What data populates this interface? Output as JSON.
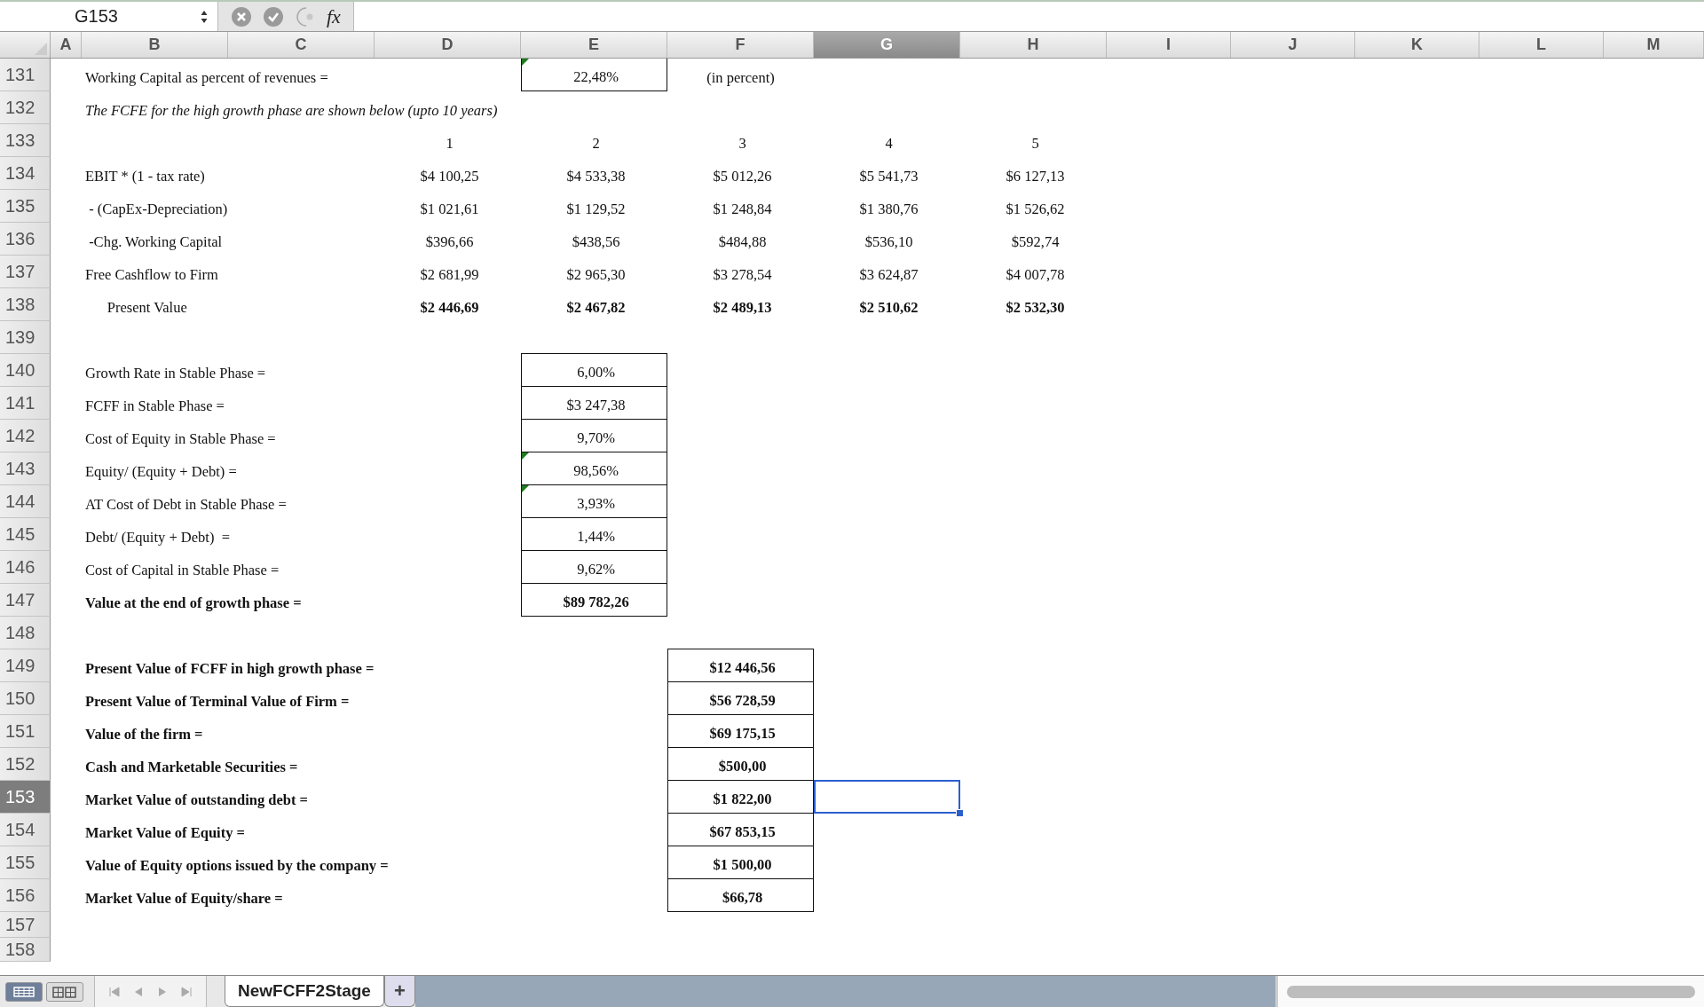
{
  "formula_bar": {
    "name_box": "G153",
    "fx": "fx"
  },
  "columns": [
    {
      "label": "A",
      "selected": false
    },
    {
      "label": "B",
      "selected": false
    },
    {
      "label": "C",
      "selected": false
    },
    {
      "label": "D",
      "selected": false
    },
    {
      "label": "E",
      "selected": false
    },
    {
      "label": "F",
      "selected": false
    },
    {
      "label": "G",
      "selected": true
    },
    {
      "label": "H",
      "selected": false
    },
    {
      "label": "I",
      "selected": false
    },
    {
      "label": "J",
      "selected": false
    },
    {
      "label": "K",
      "selected": false
    },
    {
      "label": "L",
      "selected": false
    },
    {
      "label": "M",
      "selected": false
    }
  ],
  "rows": [
    {
      "number": "131",
      "selected": false,
      "kind": "input",
      "label": "Working Capital as percent of revenues =",
      "label_bold": false,
      "values_bold": false,
      "values": [
        {
          "text": "22,48%",
          "flag": true
        }
      ],
      "note": "(in percent)"
    },
    {
      "number": "132",
      "selected": false,
      "kind": "note",
      "label": "The FCFE for the high growth phase are shown below (upto 10 years)",
      "label_bold": false
    },
    {
      "number": "133",
      "selected": false,
      "kind": "series",
      "values_bold": false,
      "values": [
        {
          "text": "1",
          "flag": false
        },
        {
          "text": "2",
          "flag": false
        },
        {
          "text": "3",
          "flag": false
        },
        {
          "text": "4",
          "flag": false
        },
        {
          "text": "5",
          "flag": false
        }
      ]
    },
    {
      "number": "134",
      "selected": false,
      "kind": "series",
      "label": "EBIT * (1 - tax rate)",
      "label_bold": false,
      "values_bold": false,
      "values": [
        {
          "text": "$4 100,25",
          "flag": false
        },
        {
          "text": "$4 533,38",
          "flag": false
        },
        {
          "text": "$5 012,26",
          "flag": false
        },
        {
          "text": "$5 541,73",
          "flag": false
        },
        {
          "text": "$6 127,13",
          "flag": false
        }
      ]
    },
    {
      "number": "135",
      "selected": false,
      "kind": "series",
      "label": " - (CapEx-Depreciation)",
      "label_bold": false,
      "values_bold": false,
      "values": [
        {
          "text": "$1 021,61",
          "flag": false
        },
        {
          "text": "$1 129,52",
          "flag": false
        },
        {
          "text": "$1 248,84",
          "flag": false
        },
        {
          "text": "$1 380,76",
          "flag": false
        },
        {
          "text": "$1 526,62",
          "flag": false
        }
      ]
    },
    {
      "number": "136",
      "selected": false,
      "kind": "series",
      "label": " -Chg. Working Capital",
      "label_bold": false,
      "values_bold": false,
      "values": [
        {
          "text": "$396,66",
          "flag": false
        },
        {
          "text": "$438,56",
          "flag": false
        },
        {
          "text": "$484,88",
          "flag": false
        },
        {
          "text": "$536,10",
          "flag": false
        },
        {
          "text": "$592,74",
          "flag": false
        }
      ]
    },
    {
      "number": "137",
      "selected": false,
      "kind": "series",
      "label": "Free Cashflow to Firm",
      "label_bold": false,
      "values_bold": false,
      "values": [
        {
          "text": "$2 681,99",
          "flag": false
        },
        {
          "text": "$2 965,30",
          "flag": false
        },
        {
          "text": "$3 278,54",
          "flag": false
        },
        {
          "text": "$3 624,87",
          "flag": false
        },
        {
          "text": "$4 007,78",
          "flag": false
        }
      ]
    },
    {
      "number": "138",
      "selected": false,
      "kind": "series",
      "label": "      Present Value",
      "label_bold": false,
      "values_bold": true,
      "values": [
        {
          "text": "$2 446,69",
          "flag": false
        },
        {
          "text": "$2 467,82",
          "flag": false
        },
        {
          "text": "$2 489,13",
          "flag": false
        },
        {
          "text": "$2 510,62",
          "flag": false
        },
        {
          "text": "$2 532,30",
          "flag": false
        }
      ]
    },
    {
      "number": "139",
      "selected": false,
      "kind": "blank"
    },
    {
      "number": "140",
      "selected": false,
      "kind": "input",
      "label": "Growth Rate in Stable Phase =",
      "label_bold": false,
      "values_bold": false,
      "values": [
        {
          "text": "6,00%",
          "flag": false
        }
      ]
    },
    {
      "number": "141",
      "selected": false,
      "kind": "input",
      "label": "FCFF in Stable Phase =",
      "label_bold": false,
      "values_bold": false,
      "values": [
        {
          "text": "$3 247,38",
          "flag": false
        }
      ]
    },
    {
      "number": "142",
      "selected": false,
      "kind": "input",
      "label": "Cost of Equity in Stable Phase =",
      "label_bold": false,
      "values_bold": false,
      "values": [
        {
          "text": "9,70%",
          "flag": false
        }
      ]
    },
    {
      "number": "143",
      "selected": false,
      "kind": "input",
      "label": "Equity/ (Equity + Debt) =",
      "label_bold": false,
      "values_bold": false,
      "values": [
        {
          "text": "98,56%",
          "flag": true
        }
      ]
    },
    {
      "number": "144",
      "selected": false,
      "kind": "input",
      "label": "AT Cost of Debt in Stable Phase =",
      "label_bold": false,
      "values_bold": false,
      "values": [
        {
          "text": "3,93%",
          "flag": true
        }
      ]
    },
    {
      "number": "145",
      "selected": false,
      "kind": "input",
      "label": "Debt/ (Equity + Debt)  =",
      "label_bold": false,
      "values_bold": false,
      "values": [
        {
          "text": "1,44%",
          "flag": false
        }
      ]
    },
    {
      "number": "146",
      "selected": false,
      "kind": "input",
      "label": "Cost of Capital in Stable Phase =",
      "label_bold": false,
      "values_bold": false,
      "values": [
        {
          "text": "9,62%",
          "flag": false
        }
      ]
    },
    {
      "number": "147",
      "selected": false,
      "kind": "input",
      "label": "Value at the end of growth phase =",
      "label_bold": true,
      "values_bold": true,
      "values": [
        {
          "text": "$89 782,26",
          "flag": false
        }
      ]
    },
    {
      "number": "148",
      "selected": false,
      "kind": "blank"
    },
    {
      "number": "149",
      "selected": false,
      "kind": "result",
      "label": "Present Value of FCFF in high growth phase =",
      "label_bold": true,
      "values_bold": true,
      "values": [
        {
          "text": "$12 446,56",
          "flag": false
        }
      ]
    },
    {
      "number": "150",
      "selected": false,
      "kind": "result",
      "label": "Present Value of Terminal Value of Firm =",
      "label_bold": true,
      "values_bold": true,
      "values": [
        {
          "text": "$56 728,59",
          "flag": false
        }
      ]
    },
    {
      "number": "151",
      "selected": false,
      "kind": "result",
      "label": "Value of the firm =",
      "label_bold": true,
      "values_bold": true,
      "values": [
        {
          "text": "$69 175,15",
          "flag": false
        }
      ]
    },
    {
      "number": "152",
      "selected": false,
      "kind": "result",
      "label": "Cash and Marketable Securities =",
      "label_bold": true,
      "values_bold": true,
      "values": [
        {
          "text": "$500,00",
          "flag": false
        }
      ]
    },
    {
      "number": "153",
      "selected": true,
      "kind": "result",
      "label": "Market Value of outstanding debt =",
      "label_bold": true,
      "values_bold": true,
      "values": [
        {
          "text": "$1 822,00",
          "flag": false
        }
      ]
    },
    {
      "number": "154",
      "selected": false,
      "kind": "result",
      "label": "Market Value of Equity =",
      "label_bold": true,
      "values_bold": true,
      "values": [
        {
          "text": "$67 853,15",
          "flag": false
        }
      ]
    },
    {
      "number": "155",
      "selected": false,
      "kind": "result",
      "label": "Value of Equity options issued by the company =",
      "label_bold": true,
      "values_bold": true,
      "values": [
        {
          "text": "$1 500,00",
          "flag": false
        }
      ]
    },
    {
      "number": "156",
      "selected": false,
      "kind": "result",
      "label": "Market Value of Equity/share =",
      "label_bold": true,
      "values_bold": true,
      "values": [
        {
          "text": "$66,78",
          "flag": false
        }
      ]
    },
    {
      "number": "157",
      "selected": false,
      "kind": "blank"
    },
    {
      "number": "158",
      "selected": false,
      "kind": "blank"
    }
  ],
  "sheet_tabs": [
    {
      "label": "NewFCFF2Stage",
      "selected": true
    }
  ],
  "add_sheet": "+"
}
